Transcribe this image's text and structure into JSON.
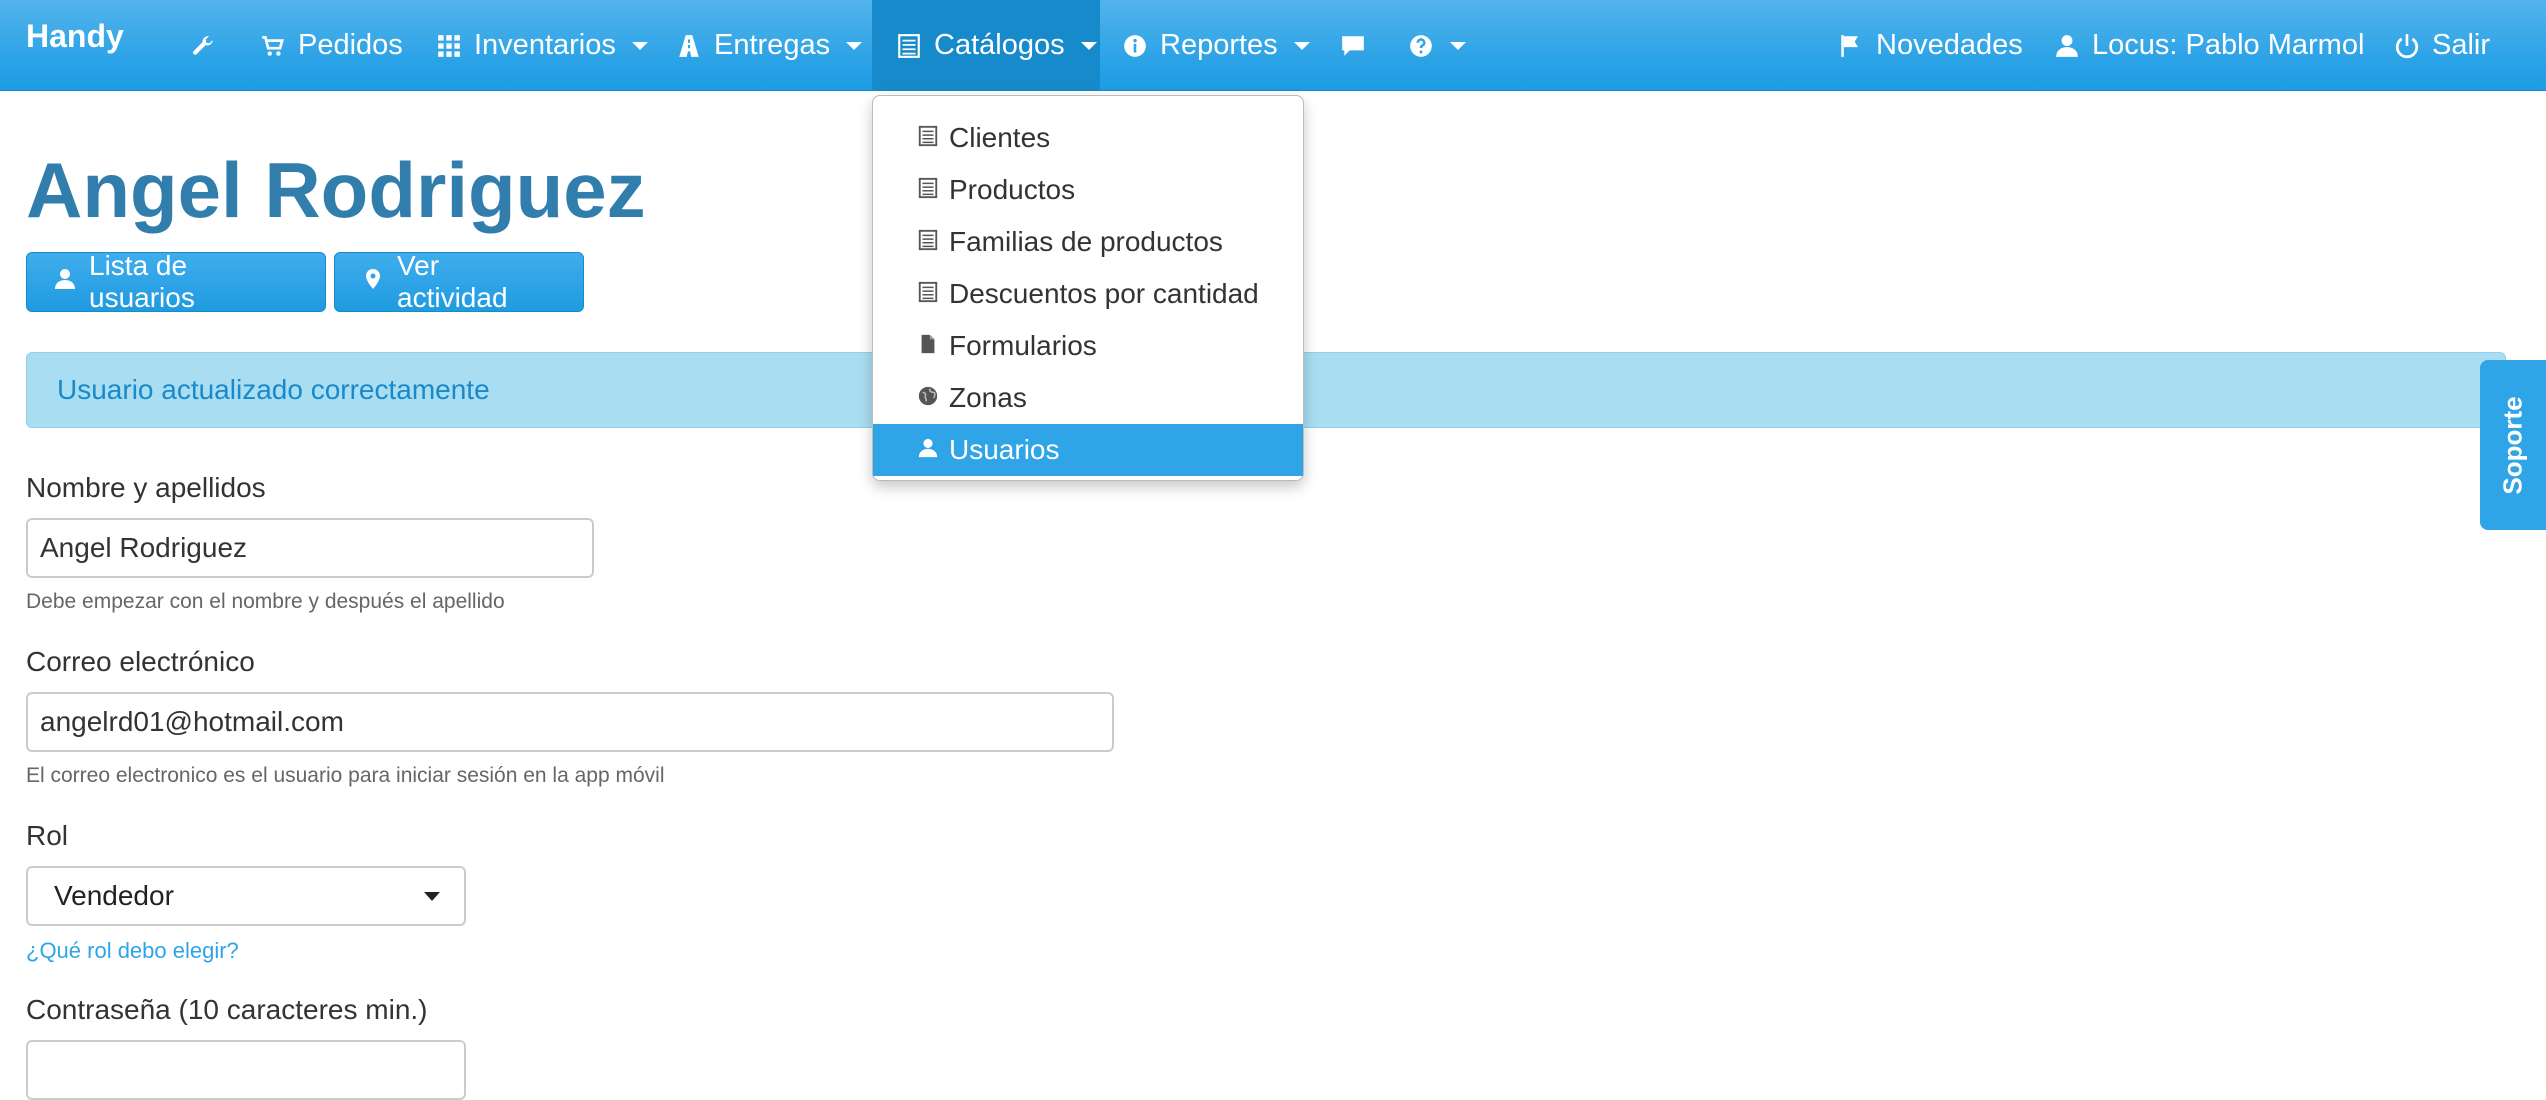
{
  "brand": "Handy",
  "nav": {
    "pedidos": "Pedidos",
    "inventarios": "Inventarios",
    "entregas": "Entregas",
    "catalogos": "Catálogos",
    "reportes": "Reportes",
    "novedades": "Novedades",
    "user": "Locus: Pablo Marmol",
    "salir": "Salir"
  },
  "dropdown": {
    "items": [
      {
        "label": "Clientes",
        "icon": "list-icon"
      },
      {
        "label": "Productos",
        "icon": "list-icon"
      },
      {
        "label": "Familias de productos",
        "icon": "list-icon"
      },
      {
        "label": "Descuentos por cantidad",
        "icon": "list-icon"
      },
      {
        "label": "Formularios",
        "icon": "file-icon"
      },
      {
        "label": "Zonas",
        "icon": "globe-icon"
      },
      {
        "label": "Usuarios",
        "icon": "user-icon",
        "active": true
      }
    ]
  },
  "page": {
    "title": "Angel Rodriguez",
    "btn_users": "Lista de usuarios",
    "btn_activity": "Ver actividad",
    "alert": "Usuario actualizado correctamente"
  },
  "form": {
    "name_label": "Nombre y apellidos",
    "name_value": "Angel Rodriguez",
    "name_help": "Debe empezar con el nombre y después el apellido",
    "email_label": "Correo electrónico",
    "email_value": "angelrd01@hotmail.com",
    "email_help": "El correo electronico es el usuario para iniciar sesión en la app móvil",
    "role_label": "Rol",
    "role_value": "Vendedor",
    "role_help": "¿Qué rol debo elegir?",
    "password_label": "Contraseña (10 caracteres min.)"
  },
  "support": "Soporte",
  "colors": {
    "primary": "#2fa4e7",
    "active_nav": "#178acc",
    "title": "#317eac",
    "alert_bg": "#a9def2"
  }
}
